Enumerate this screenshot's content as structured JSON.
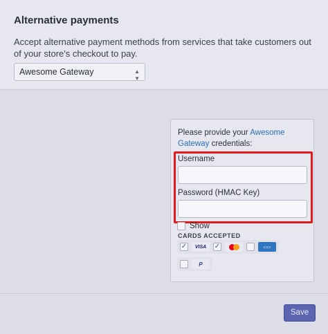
{
  "section": {
    "title": "Alternative payments",
    "description": "Accept alternative payment methods from services that take customers out of your store's checkout to pay."
  },
  "gateway_select": {
    "value": "Awesome Gateway",
    "icon": "chevron-updown-icon"
  },
  "credentials": {
    "intro_before": "Please provide your ",
    "intro_link": "Awesome Gateway",
    "intro_after": " credentials:",
    "username_label": "Username",
    "username_value": "",
    "password_label": "Password (HMAC Key)",
    "password_value": ""
  },
  "show": {
    "label": "Show",
    "checked": false
  },
  "cards": {
    "title": "CARDS ACCEPTED",
    "items": [
      {
        "name": "VISA",
        "checked": true
      },
      {
        "name": "Mastercard",
        "checked": true
      },
      {
        "name": "American Express",
        "checked": false
      },
      {
        "name": "PayPal",
        "checked": false
      }
    ]
  },
  "actions": {
    "save_label": "Save"
  },
  "colors": {
    "accent": "#5b65b0",
    "link": "#2a6fb5",
    "highlight": "#e01b1b"
  }
}
